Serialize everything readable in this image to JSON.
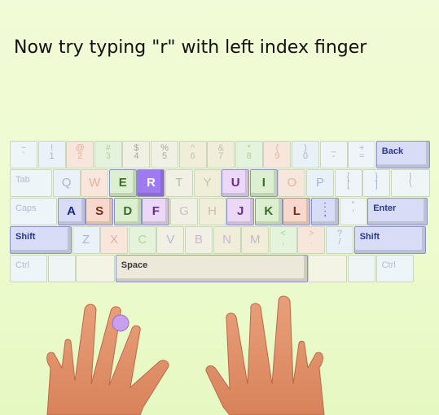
{
  "instruction": "Now try typing \"r\" with left index finger",
  "highlight_finger": "left-index",
  "highlight_color": "#c8a0f0",
  "keyboard": {
    "rows": [
      [
        {
          "name": "key-backtick",
          "top": "~",
          "bottom": "`",
          "bg": "#eef5f9",
          "fg": "#a8b4c8"
        },
        {
          "name": "key-1",
          "top": "!",
          "bottom": "1",
          "bg": "#eaf1f8",
          "fg": "#a8b4c8"
        },
        {
          "name": "key-2",
          "top": "@",
          "bottom": "2",
          "bg": "#f8e5dc",
          "fg": "#e0b09c"
        },
        {
          "name": "key-3",
          "top": "#",
          "bottom": "3",
          "bg": "#e6f3dc",
          "fg": "#b3d3a0"
        },
        {
          "name": "key-4",
          "top": "$",
          "bottom": "4",
          "bg": "#f0f0e4",
          "fg": "#a8a8a0"
        },
        {
          "name": "key-5",
          "top": "%",
          "bottom": "5",
          "bg": "#f0f0e4",
          "fg": "#a8a8a0"
        },
        {
          "name": "key-6",
          "top": "^",
          "bottom": "6",
          "bg": "#f0eed8",
          "fg": "#c8c0a8"
        },
        {
          "name": "key-7",
          "top": "&",
          "bottom": "7",
          "bg": "#f0eed8",
          "fg": "#c8c0a8"
        },
        {
          "name": "key-8",
          "top": "*",
          "bottom": "8",
          "bg": "#e4f4dc",
          "fg": "#a8d098"
        },
        {
          "name": "key-9",
          "top": "(",
          "bottom": "9",
          "bg": "#f6e6dc",
          "fg": "#e0b8a0"
        },
        {
          "name": "key-0",
          "top": ")",
          "bottom": "0",
          "bg": "#e8f1f8",
          "fg": "#a8b4c8"
        },
        {
          "name": "key-minus",
          "top": "_",
          "bottom": "-",
          "bg": "#eef4f8",
          "fg": "#a8b4c8"
        },
        {
          "name": "key-equals",
          "top": "+",
          "bottom": "=",
          "bg": "#eef4f8",
          "fg": "#a8b4c8"
        },
        {
          "name": "key-back",
          "label": "Back",
          "bg": "#d8dcf6",
          "fg": "#2a3a8a",
          "active": true
        }
      ],
      [
        {
          "name": "key-tab",
          "label": "Tab",
          "bg": "#eef5f9",
          "fg": "#b0bcd0"
        },
        {
          "name": "key-q",
          "letter": "Q",
          "bg": "#eaf1f8",
          "fg": "#a8b4d8"
        },
        {
          "name": "key-w",
          "letter": "W",
          "bg": "#f8e5dc",
          "fg": "#e0b09c"
        },
        {
          "name": "key-e",
          "letter": "E",
          "bg": "#dcefd0",
          "fg": "#3a6a2a",
          "active": true
        },
        {
          "name": "key-r",
          "letter": "R",
          "bg": "#a07af0",
          "fg": "#ffffff",
          "active": true
        },
        {
          "name": "key-t",
          "letter": "T",
          "bg": "#f0f0e4",
          "fg": "#b8b8a8"
        },
        {
          "name": "key-y",
          "letter": "Y",
          "bg": "#f0eed8",
          "fg": "#c8c0a8"
        },
        {
          "name": "key-u",
          "letter": "U",
          "bg": "#ead8f6",
          "fg": "#6a2a8a",
          "active": true
        },
        {
          "name": "key-i",
          "letter": "I",
          "bg": "#dcefd0",
          "fg": "#3a6a2a",
          "active": true
        },
        {
          "name": "key-o",
          "letter": "O",
          "bg": "#f6e6dc",
          "fg": "#e0b8a0"
        },
        {
          "name": "key-p",
          "letter": "P",
          "bg": "#e8f1f8",
          "fg": "#a8b4d8"
        },
        {
          "name": "key-lbracket",
          "top": "{",
          "bottom": "[",
          "bg": "#eef4f8",
          "fg": "#a8b4c8"
        },
        {
          "name": "key-rbracket",
          "top": "}",
          "bottom": "]",
          "bg": "#eef4f8",
          "fg": "#a8b4c8"
        },
        {
          "name": "key-backslash",
          "top": "|",
          "bottom": "\\",
          "bg": "#eef5f4",
          "fg": "#a8b4c8"
        }
      ],
      [
        {
          "name": "key-caps",
          "label": "Caps",
          "bg": "#eef5f9",
          "fg": "#b0bcd0"
        },
        {
          "name": "key-a",
          "letter": "A",
          "bg": "#d8dcf6",
          "fg": "#1a2a7a",
          "active": true
        },
        {
          "name": "key-s",
          "letter": "S",
          "bg": "#f6d8cc",
          "fg": "#7a2a1a",
          "active": true
        },
        {
          "name": "key-d",
          "letter": "D",
          "bg": "#dcefd0",
          "fg": "#3a6a2a",
          "active": true
        },
        {
          "name": "key-f",
          "letter": "F",
          "bg": "#ead8f6",
          "fg": "#6a2a8a",
          "active": true
        },
        {
          "name": "key-g",
          "letter": "G",
          "bg": "#f0f0e4",
          "fg": "#c8c0c8"
        },
        {
          "name": "key-h",
          "letter": "H",
          "bg": "#f0eed8",
          "fg": "#c8c0a8"
        },
        {
          "name": "key-j",
          "letter": "J",
          "bg": "#ead8f6",
          "fg": "#6a2a8a",
          "active": true
        },
        {
          "name": "key-k",
          "letter": "K",
          "bg": "#dcefd0",
          "fg": "#3a6a2a",
          "active": true
        },
        {
          "name": "key-l",
          "letter": "L",
          "bg": "#f6d8cc",
          "fg": "#7a2a1a",
          "active": true
        },
        {
          "name": "key-semicolon",
          "top": ":",
          "bottom": ";",
          "bg": "#d8dcf6",
          "fg": "#1a2a7a",
          "active": true
        },
        {
          "name": "key-quote",
          "top": "\"",
          "bottom": "'",
          "bg": "#eef4f8",
          "fg": "#a8b4c8"
        },
        {
          "name": "key-enter",
          "label": "Enter",
          "bg": "#d8dcf6",
          "fg": "#2a3a8a",
          "active": true
        }
      ],
      [
        {
          "name": "key-shift-left",
          "label": "Shift",
          "bg": "#d8dcf6",
          "fg": "#2a3a8a",
          "active": true
        },
        {
          "name": "key-z",
          "letter": "Z",
          "bg": "#eaf1f8",
          "fg": "#a8b4d8"
        },
        {
          "name": "key-x",
          "letter": "X",
          "bg": "#f8e5dc",
          "fg": "#e0b09c"
        },
        {
          "name": "key-c",
          "letter": "C",
          "bg": "#e6f3dc",
          "fg": "#b3d3a0"
        },
        {
          "name": "key-v",
          "letter": "V",
          "bg": "#f0f0e4",
          "fg": "#b8b8c8"
        },
        {
          "name": "key-b",
          "letter": "B",
          "bg": "#f0f0e4",
          "fg": "#c8b8c8"
        },
        {
          "name": "key-n",
          "letter": "N",
          "bg": "#f0eed8",
          "fg": "#c8b8c8"
        },
        {
          "name": "key-m",
          "letter": "M",
          "bg": "#f0eed8",
          "fg": "#c8b8c8"
        },
        {
          "name": "key-comma",
          "top": "<",
          "bottom": ",",
          "bg": "#e4f4dc",
          "fg": "#a8d098"
        },
        {
          "name": "key-period",
          "top": ">",
          "bottom": ".",
          "bg": "#f6e6dc",
          "fg": "#e0b8a0"
        },
        {
          "name": "key-slash",
          "top": "?",
          "bottom": "/",
          "bg": "#e8f1f8",
          "fg": "#a8b4c8"
        },
        {
          "name": "key-shift-right",
          "label": "Shift",
          "bg": "#d8dcf6",
          "fg": "#2a3a8a",
          "active": true
        }
      ],
      [
        {
          "name": "key-ctrl-left",
          "label": "Ctrl",
          "bg": "#eef5f9",
          "fg": "#b0bcd0"
        },
        {
          "name": "key-win-left",
          "label": "",
          "bg": "#eef5f4",
          "fg": "#b0bcd0"
        },
        {
          "name": "key-alt-left",
          "label": "",
          "bg": "#f4f4e4",
          "fg": "#b0bcd0"
        },
        {
          "name": "key-space",
          "label": "Space",
          "bg": "#ece8da",
          "fg": "#3a3a3a",
          "active": true
        },
        {
          "name": "key-alt-right",
          "label": "",
          "bg": "#f4f4e4",
          "fg": "#b0bcd0"
        },
        {
          "name": "key-win-right",
          "label": "",
          "bg": "#eef5f4",
          "fg": "#b0bcd0"
        },
        {
          "name": "key-ctrl-right",
          "label": "Ctrl",
          "bg": "#eef5f9",
          "fg": "#b0bcd0"
        }
      ]
    ]
  }
}
